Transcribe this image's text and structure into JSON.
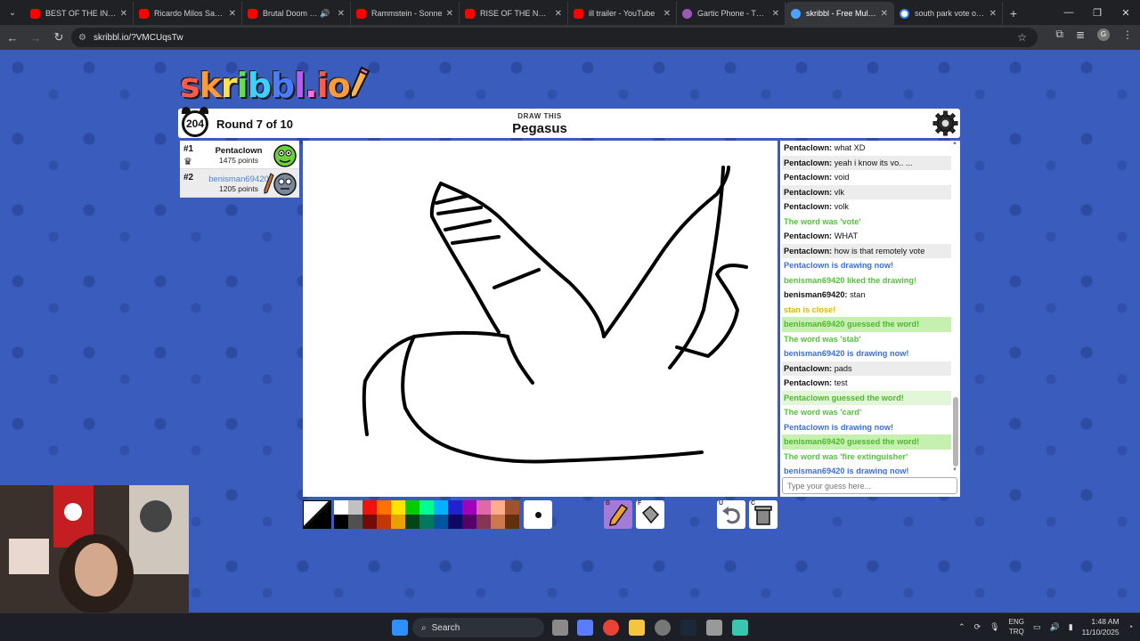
{
  "browser": {
    "tabs": [
      {
        "title": "BEST OF THE INTERNET",
        "icon": "youtube-icon"
      },
      {
        "title": "Ricardo Milos Saves T",
        "icon": "youtube-icon"
      },
      {
        "title": "Brutal Doom - M",
        "icon": "youtube-icon",
        "audio": true
      },
      {
        "title": "Rammstein - Sonne",
        "icon": "youtube-icon"
      },
      {
        "title": "RISE OF THE NORTH",
        "icon": "youtube-icon"
      },
      {
        "title": "ill trailer - YouTube",
        "icon": "youtube-icon"
      },
      {
        "title": "Gartic Phone - The Te",
        "icon": "gartic-icon"
      },
      {
        "title": "skribbl - Free Multipl",
        "icon": "skribbl-icon",
        "active": true
      },
      {
        "title": "south park vote or de",
        "icon": "google-icon"
      }
    ],
    "url": "skribbl.io/?VMCUqsTw",
    "profile_initial": "G"
  },
  "game": {
    "logo_letters": [
      {
        "ch": "s",
        "color": "#ff5a4e"
      },
      {
        "ch": "k",
        "color": "#ff9a3c"
      },
      {
        "ch": "r",
        "color": "#ffe14a"
      },
      {
        "ch": "i",
        "color": "#5ce05c"
      },
      {
        "ch": "b",
        "color": "#3ed1ff"
      },
      {
        "ch": "b",
        "color": "#4a7dff"
      },
      {
        "ch": "l",
        "color": "#b75cff"
      },
      {
        "ch": ".",
        "color": "#ff6fd8"
      },
      {
        "ch": "i",
        "color": "#ff5a4e"
      },
      {
        "ch": "o",
        "color": "#ff9a3c"
      }
    ],
    "timer": "204",
    "round_text": "Round 7 of 10",
    "draw_label": "DRAW THIS",
    "word": "Pegasus",
    "players": [
      {
        "rank": "#1",
        "name": "Pentaclown",
        "points": "1475 points",
        "crown": true,
        "me": false
      },
      {
        "rank": "#2",
        "name": "benisman69420",
        "points": "1205 points",
        "crown": false,
        "me": true
      }
    ],
    "chat": [
      {
        "type": "user",
        "name": "Pentaclown:",
        "text": "what XD"
      },
      {
        "type": "user",
        "name": "Pentaclown:",
        "text": "yeah i know its vo.. ..."
      },
      {
        "type": "user",
        "name": "Pentaclown:",
        "text": "void"
      },
      {
        "type": "user",
        "name": "Pentaclown:",
        "text": "vlk"
      },
      {
        "type": "user",
        "name": "Pentaclown:",
        "text": "volk"
      },
      {
        "type": "sys-green",
        "text": "The word was 'vote'"
      },
      {
        "type": "user",
        "name": "Pentaclown:",
        "text": "WHAT"
      },
      {
        "type": "user",
        "name": "Pentaclown:",
        "text": "how is that remotely vote"
      },
      {
        "type": "sys-blue",
        "text": "Pentaclown is drawing now!"
      },
      {
        "type": "sys-green",
        "text": "benisman69420 liked the drawing!"
      },
      {
        "type": "user",
        "name": "benisman69420:",
        "text": "stan"
      },
      {
        "type": "sys-yellow",
        "text": "stan is close!"
      },
      {
        "type": "hl",
        "text": "benisman69420 guessed the word!"
      },
      {
        "type": "sys-green",
        "text": "The word was 'stab'"
      },
      {
        "type": "sys-blue",
        "text": "benisman69420 is drawing now!"
      },
      {
        "type": "user",
        "name": "Pentaclown:",
        "text": "pads"
      },
      {
        "type": "user",
        "name": "Pentaclown:",
        "text": "test"
      },
      {
        "type": "hl2",
        "text": "Pentaclown guessed the word!"
      },
      {
        "type": "sys-green",
        "text": "The word was 'card'"
      },
      {
        "type": "sys-blue",
        "text": "Pentaclown is drawing now!"
      },
      {
        "type": "hl",
        "text": "benisman69420 guessed the word!"
      },
      {
        "type": "sys-green",
        "text": "The word was 'fire extinguisher'"
      },
      {
        "type": "sys-blue",
        "text": "benisman69420 is drawing now!"
      }
    ],
    "chat_placeholder": "Type your guess here...",
    "palette_top": [
      "#ffffff",
      "#c1c1c1",
      "#ef130b",
      "#ff7100",
      "#ffe400",
      "#00cc00",
      "#00ff91",
      "#00b2ff",
      "#231fd3",
      "#a300ba",
      "#df69a7",
      "#ffac8e",
      "#a0522d"
    ],
    "palette_bottom": [
      "#000000",
      "#505050",
      "#740b07",
      "#c23800",
      "#e8a200",
      "#004619",
      "#00785d",
      "#00569e",
      "#0e0865",
      "#550069",
      "#873554",
      "#cc774d",
      "#63300d"
    ],
    "tools": {
      "brush_key": "B",
      "fill_key": "F",
      "undo_key": "U",
      "clear_key": "C"
    }
  },
  "taskbar": {
    "search_label": "Search",
    "lang_top": "ENG",
    "lang_bottom": "TRQ",
    "time": "1:48 AM",
    "date": "11/10/2025"
  }
}
